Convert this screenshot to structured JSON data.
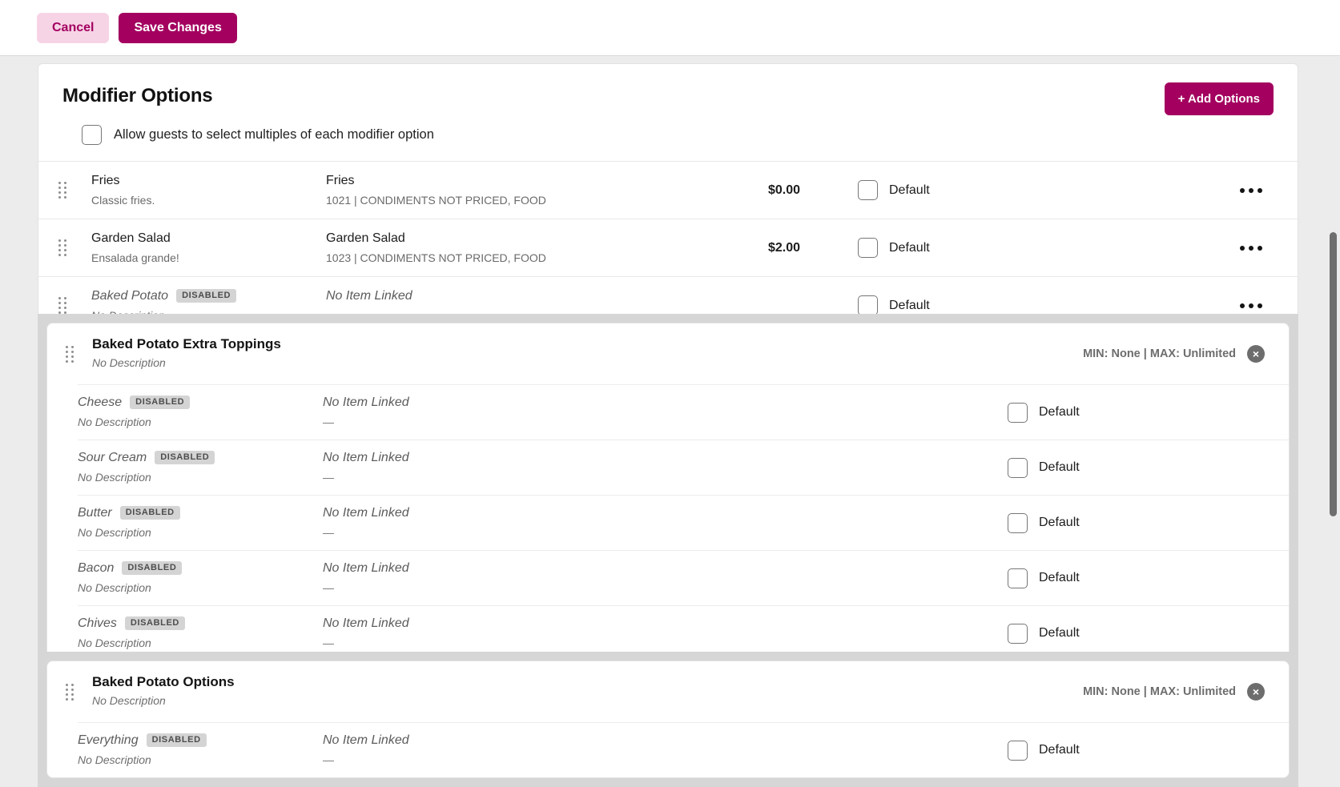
{
  "toolbar": {
    "cancel_label": "Cancel",
    "save_label": "Save Changes"
  },
  "panel": {
    "title": "Modifier Options",
    "add_options_label": "+ Add Options",
    "allow_multiples_label": "Allow guests to select multiples of each modifier option",
    "allow_multiples_checked": false
  },
  "labels": {
    "default": "Default",
    "no_item_linked": "No Item Linked",
    "no_description": "No Description",
    "dash": "—",
    "disabled_badge": "DISABLED",
    "close": "×"
  },
  "options": [
    {
      "name": "Fries",
      "description": "Classic fries.",
      "item": "Fries",
      "item_meta": "1021  |  CONDIMENTS NOT PRICED, FOOD",
      "price": "$0.00",
      "default_label": "Default",
      "default_checked": false,
      "disabled": false
    },
    {
      "name": "Garden Salad",
      "description": "Ensalada grande!",
      "item": "Garden Salad",
      "item_meta": "1023  |  CONDIMENTS NOT PRICED, FOOD",
      "price": "$2.00",
      "default_label": "Default",
      "default_checked": false,
      "disabled": false
    },
    {
      "name": "Baked Potato",
      "badge": "DISABLED",
      "description": "No Description",
      "item": "No Item Linked",
      "item_meta": "—",
      "price": "",
      "default_label": "Default",
      "default_checked": false,
      "disabled": true
    }
  ],
  "groups": [
    {
      "title": "Baked Potato Extra Toppings",
      "description": "No Description",
      "constraints": "MIN: None | MAX: Unlimited",
      "rows": [
        {
          "name": "Cheese",
          "badge": "DISABLED",
          "description": "No Description",
          "item": "No Item Linked",
          "item_meta": "—",
          "default_label": "Default",
          "default_checked": false
        },
        {
          "name": "Sour Cream",
          "badge": "DISABLED",
          "description": "No Description",
          "item": "No Item Linked",
          "item_meta": "—",
          "default_label": "Default",
          "default_checked": false
        },
        {
          "name": "Butter",
          "badge": "DISABLED",
          "description": "No Description",
          "item": "No Item Linked",
          "item_meta": "—",
          "default_label": "Default",
          "default_checked": false
        },
        {
          "name": "Bacon",
          "badge": "DISABLED",
          "description": "No Description",
          "item": "No Item Linked",
          "item_meta": "—",
          "default_label": "Default",
          "default_checked": false
        },
        {
          "name": "Chives",
          "badge": "DISABLED",
          "description": "No Description",
          "item": "No Item Linked",
          "item_meta": "—",
          "default_label": "Default",
          "default_checked": false
        }
      ]
    },
    {
      "title": "Baked Potato Options",
      "description": "No Description",
      "constraints": "MIN: None | MAX: Unlimited",
      "rows": [
        {
          "name": "Everything",
          "badge": "DISABLED",
          "description": "No Description",
          "item": "No Item Linked",
          "item_meta": "—",
          "default_label": "Default",
          "default_checked": false
        }
      ]
    }
  ],
  "colors": {
    "brand": "#a3005f",
    "brand_light": "#f6d4e6",
    "page_bg": "#ececec",
    "group_bg": "#d6d6d6"
  }
}
